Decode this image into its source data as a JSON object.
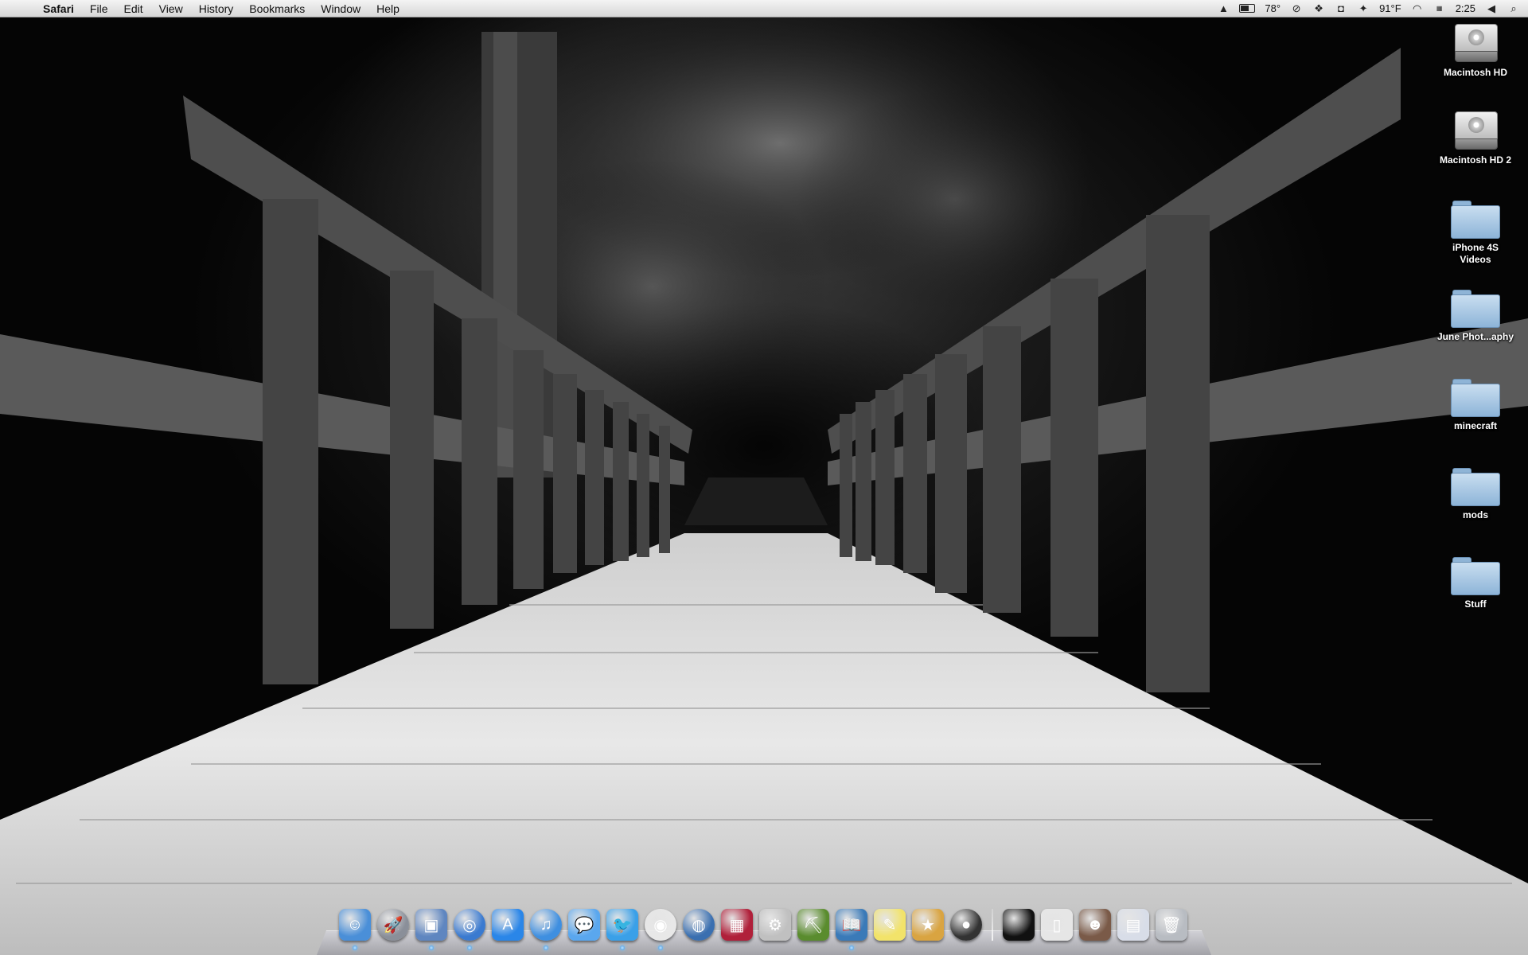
{
  "menubar": {
    "apple_symbol": "",
    "app_name": "Safari",
    "menus": [
      "File",
      "Edit",
      "View",
      "History",
      "Bookmarks",
      "Window",
      "Help"
    ],
    "status": {
      "temp_1": "78°",
      "temp_2": "91°F",
      "time": "2:25"
    },
    "status_icons": [
      "google-drive-icon",
      "battery-icon",
      "sync-icon",
      "dropbox-icon",
      "screenshot-icon",
      "evernote-icon",
      "wifi-icon",
      "date-icon",
      "volume-icon",
      "spotlight-icon"
    ]
  },
  "desktop": {
    "icons": [
      {
        "label": "Macintosh HD",
        "type": "hard-drive"
      },
      {
        "label": "Macintosh HD 2",
        "type": "hard-drive"
      },
      {
        "label": "iPhone 4S Videos",
        "type": "folder"
      },
      {
        "label": "June Phot...aphy",
        "type": "folder"
      },
      {
        "label": "minecraft",
        "type": "folder"
      },
      {
        "label": "mods",
        "type": "folder"
      },
      {
        "label": "Stuff",
        "type": "folder"
      }
    ]
  },
  "dock": {
    "apps": [
      {
        "name": "finder-icon",
        "color": "#4a8fd8",
        "glyph": "☺",
        "running": true
      },
      {
        "name": "launchpad-icon",
        "color": "#8a8f99",
        "glyph": "🚀",
        "running": false
      },
      {
        "name": "preview-icon",
        "color": "#5f86c0",
        "glyph": "▣",
        "running": true
      },
      {
        "name": "safari-icon",
        "color": "#3a7ad0",
        "glyph": "◎",
        "running": true
      },
      {
        "name": "app-store-icon",
        "color": "#2a86e8",
        "glyph": "A",
        "running": false
      },
      {
        "name": "itunes-icon",
        "color": "#3f8fe0",
        "glyph": "♫",
        "running": true
      },
      {
        "name": "messages-icon",
        "color": "#5aa7ee",
        "glyph": "💬",
        "running": false
      },
      {
        "name": "twitter-icon",
        "color": "#3aa0e8",
        "glyph": "🐦",
        "running": true
      },
      {
        "name": "chrome-icon",
        "color": "#e8e8e8",
        "glyph": "◉",
        "running": true
      },
      {
        "name": "network-globe-icon",
        "color": "#3a6fb0",
        "glyph": "◍",
        "running": false
      },
      {
        "name": "equalizer-icon",
        "color": "#b0203a",
        "glyph": "▦",
        "running": false
      },
      {
        "name": "automator-icon",
        "color": "#c0c0c0",
        "glyph": "⚙",
        "running": false
      },
      {
        "name": "minecraft-icon",
        "color": "#5a8c2e",
        "glyph": "⛏",
        "running": false
      },
      {
        "name": "dictionary-icon",
        "color": "#3a7ab8",
        "glyph": "📖",
        "running": true
      },
      {
        "name": "stickies-icon",
        "color": "#f2e36a",
        "glyph": "✎",
        "running": false
      },
      {
        "name": "package-icon",
        "color": "#d9a441",
        "glyph": "★",
        "running": false
      },
      {
        "name": "photo-booth-icon",
        "color": "#333333",
        "glyph": "●",
        "running": false
      }
    ],
    "stack_items": [
      {
        "name": "apple-stack-icon",
        "color": "#111111",
        "glyph": ""
      },
      {
        "name": "iphone-stack-icon",
        "color": "#e6e6e6",
        "glyph": "▯"
      },
      {
        "name": "photo-stack-icon",
        "color": "#7a5a48",
        "glyph": "☻"
      },
      {
        "name": "documents-stack-icon",
        "color": "#d8dde8",
        "glyph": "▤"
      },
      {
        "name": "trash-icon",
        "color": "#b8bcc2",
        "glyph": "🗑"
      }
    ]
  }
}
